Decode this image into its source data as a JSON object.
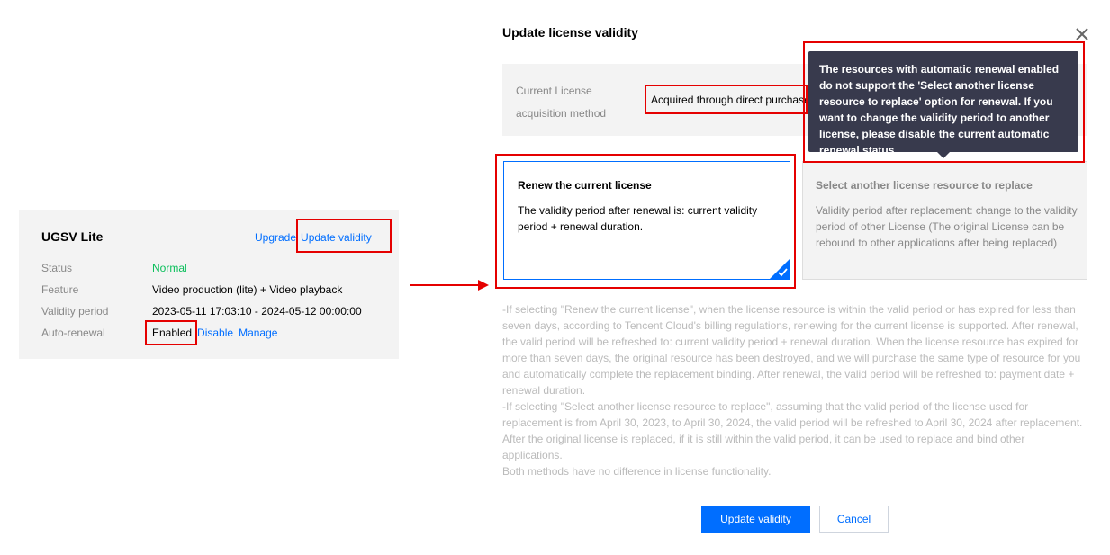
{
  "card": {
    "title": "UGSV Lite",
    "upgrade_label": "Upgrade",
    "update_label": "Update validity",
    "rows": [
      {
        "label": "Status",
        "value": "Normal"
      },
      {
        "label": "Feature",
        "value": "Video production (lite) + Video playback"
      },
      {
        "label": "Validity period",
        "value": "2023-05-11 17:03:10 - 2024-05-12 00:00:00"
      },
      {
        "label": "Auto-renewal",
        "value": "Enabled"
      }
    ],
    "disable_label": "Disable",
    "manage_label": "Manage"
  },
  "dialog": {
    "title": "Update license validity",
    "method_label": "Current License acquisition method",
    "method_value": "Acquired through direct purchase",
    "tooltip": "The resources with automatic renewal enabled do not support the 'Select another license resource to replace' option for renewal. If you want to change the validity period to another license, please disable the current automatic renewal status.",
    "option_renew": {
      "title": "Renew the current license",
      "desc": "The validity period after renewal is: current validity period + renewal duration."
    },
    "option_replace": {
      "title": "Select another license resource to replace",
      "desc": "Validity period after replacement: change to the validity period of other License (The original License can be rebound to other applications after being replaced)"
    },
    "notes": [
      "-If selecting \"Renew the current license\", when the license resource is within the valid period or has expired for less than seven days, according to Tencent Cloud's billing regulations, renewing for the current license is supported. After renewal, the valid period will be refreshed to: current validity period + renewal duration. When the license resource has expired for more than seven days, the original resource has been destroyed, and we will purchase the same type of resource for you and automatically complete the replacement binding. After renewal, the valid period will be refreshed to: payment date + renewal duration.",
      "-If selecting \"Select another license resource to replace\", assuming that the valid period of the license used for replacement is from April 30, 2023, to April 30, 2024, the valid period will be refreshed to April 30, 2024 after replacement. After the original license is replaced, if it is still within the valid period, it can be used to replace and bind other applications.",
      "Both methods have no difference in license functionality."
    ],
    "confirm_label": "Update validity",
    "cancel_label": "Cancel"
  },
  "colors": {
    "accent": "#006eff",
    "highlight": "#e50000",
    "status_ok": "#0abf5b",
    "tooltip_bg": "#383a4d"
  }
}
